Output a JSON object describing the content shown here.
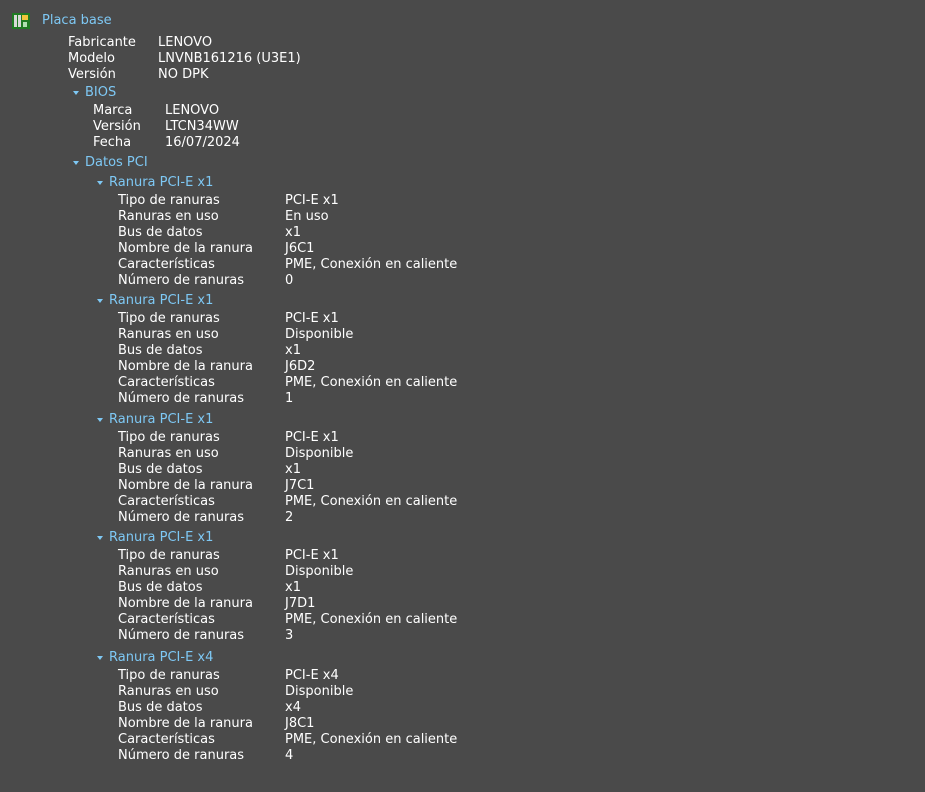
{
  "root": {
    "label": "Placa base",
    "icon": "motherboard-icon"
  },
  "mainboard": [
    {
      "label": "Fabricante",
      "value": "LENOVO"
    },
    {
      "label": "Modelo",
      "value": "LNVNB161216 (U3E1)"
    },
    {
      "label": "Versión",
      "value": "NO DPK"
    }
  ],
  "bios": {
    "title": "BIOS",
    "rows": [
      {
        "label": "Marca",
        "value": "LENOVO"
      },
      {
        "label": "Versión",
        "value": "LTCN34WW"
      },
      {
        "label": "Fecha",
        "value": "16/07/2024"
      }
    ]
  },
  "pci": {
    "title": "Datos PCI",
    "slots": [
      {
        "title": "Ranura PCI-E x1",
        "rows": [
          {
            "label": "Tipo de ranuras",
            "value": "PCI-E x1"
          },
          {
            "label": "Ranuras en uso",
            "value": "En uso"
          },
          {
            "label": "Bus de datos",
            "value": "x1"
          },
          {
            "label": "Nombre de la ranura",
            "value": "J6C1"
          },
          {
            "label": "Características",
            "value": "PME, Conexión en caliente"
          },
          {
            "label": "Número de ranuras",
            "value": "0"
          }
        ]
      },
      {
        "title": "Ranura PCI-E x1",
        "rows": [
          {
            "label": "Tipo de ranuras",
            "value": "PCI-E x1"
          },
          {
            "label": "Ranuras en uso",
            "value": "Disponible"
          },
          {
            "label": "Bus de datos",
            "value": "x1"
          },
          {
            "label": "Nombre de la ranura",
            "value": "J6D2"
          },
          {
            "label": "Características",
            "value": "PME, Conexión en caliente"
          },
          {
            "label": "Número de ranuras",
            "value": "1"
          }
        ]
      },
      {
        "title": "Ranura PCI-E x1",
        "rows": [
          {
            "label": "Tipo de ranuras",
            "value": "PCI-E x1"
          },
          {
            "label": "Ranuras en uso",
            "value": "Disponible"
          },
          {
            "label": "Bus de datos",
            "value": "x1"
          },
          {
            "label": "Nombre de la ranura",
            "value": "J7C1"
          },
          {
            "label": "Características",
            "value": "PME, Conexión en caliente"
          },
          {
            "label": "Número de ranuras",
            "value": "2"
          }
        ]
      },
      {
        "title": "Ranura PCI-E x1",
        "rows": [
          {
            "label": "Tipo de ranuras",
            "value": "PCI-E x1"
          },
          {
            "label": "Ranuras en uso",
            "value": "Disponible"
          },
          {
            "label": "Bus de datos",
            "value": "x1"
          },
          {
            "label": "Nombre de la ranura",
            "value": "J7D1"
          },
          {
            "label": "Características",
            "value": "PME, Conexión en caliente"
          },
          {
            "label": "Número de ranuras",
            "value": "3"
          }
        ]
      },
      {
        "title": "Ranura PCI-E x4",
        "rows": [
          {
            "label": "Tipo de ranuras",
            "value": "PCI-E x4"
          },
          {
            "label": "Ranuras en uso",
            "value": "Disponible"
          },
          {
            "label": "Bus de datos",
            "value": "x4"
          },
          {
            "label": "Nombre de la ranura",
            "value": "J8C1"
          },
          {
            "label": "Características",
            "value": "PME, Conexión en caliente"
          },
          {
            "label": "Número de ranuras",
            "value": "4"
          }
        ]
      }
    ]
  }
}
